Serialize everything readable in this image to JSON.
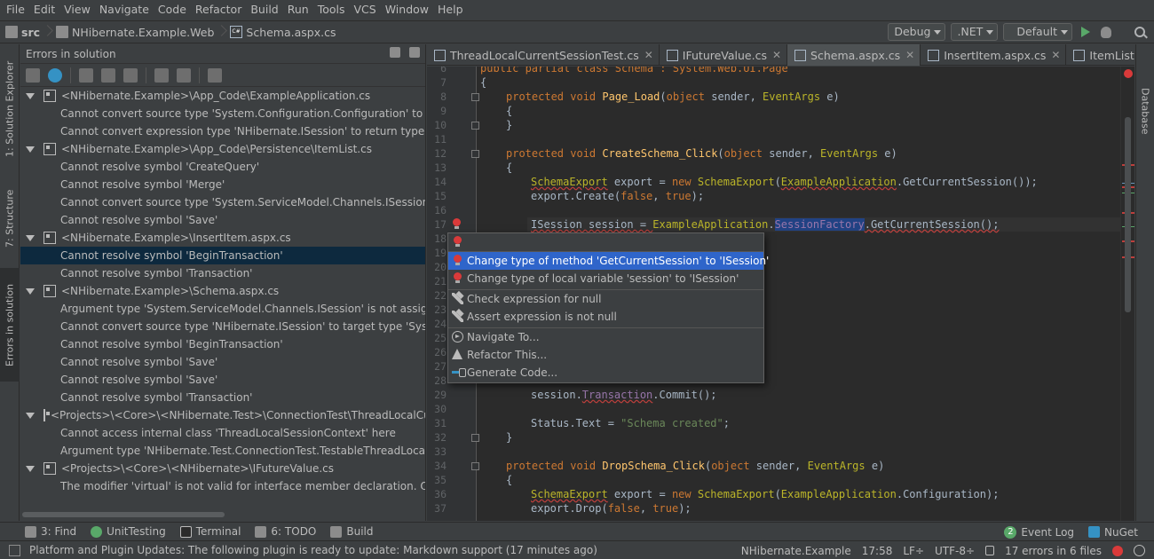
{
  "menu": [
    "File",
    "Edit",
    "View",
    "Navigate",
    "Code",
    "Refactor",
    "Build",
    "Run",
    "Tools",
    "VCS",
    "Window",
    "Help"
  ],
  "breadcrumb": [
    "src",
    "NHibernate.Example.Web",
    "Schema.aspx.cs"
  ],
  "run_config": {
    "configuration": "Debug",
    "platform": ".NET",
    "profile": "Default"
  },
  "left_stripe_tabs": [
    "1: Solution Explorer",
    "7: Structure",
    "Errors in solution"
  ],
  "errors_panel": {
    "title": "Errors in solution",
    "groups": [
      {
        "path": "<NHibernate.Example>\\App_Code\\ExampleApplication.cs",
        "items": [
          "Cannot convert source type 'System.Configuration.Configuration' to target type",
          "Cannot convert expression type 'NHibernate.ISession' to return type 'System.Se"
        ]
      },
      {
        "path": "<NHibernate.Example>\\App_Code\\Persistence\\ItemList.cs",
        "items": [
          "Cannot resolve symbol 'CreateQuery'",
          "Cannot resolve symbol 'Merge'",
          "Cannot convert source type 'System.ServiceModel.Channels.ISession' to target",
          "Cannot resolve symbol 'Save'"
        ]
      },
      {
        "path": "<NHibernate.Example>\\InsertItem.aspx.cs",
        "items": [
          "Cannot resolve symbol 'BeginTransaction'",
          "Cannot resolve symbol 'Transaction'"
        ]
      },
      {
        "path": "<NHibernate.Example>\\Schema.aspx.cs",
        "items": [
          "Argument type 'System.ServiceModel.Channels.ISession' is not assignable to p",
          "Cannot convert source type 'NHibernate.ISession' to target type 'System.Servic",
          "Cannot resolve symbol 'BeginTransaction'",
          "Cannot resolve symbol 'Save'",
          "Cannot resolve symbol 'Save'",
          "Cannot resolve symbol 'Transaction'"
        ]
      },
      {
        "path": "<Projects>\\<Core>\\<NHibernate.Test>\\ConnectionTest\\ThreadLocalCurrentS",
        "items": [
          "Cannot access internal class 'ThreadLocalSessionContext' here",
          "Argument type 'NHibernate.Test.ConnectionTest.TestableThreadLocalContext"
        ]
      },
      {
        "path": "<Projects>\\<Core>\\<NHibernate>\\IFutureValue.cs",
        "items": [
          "The modifier 'virtual' is not valid for interface member declaration. Only 'new'"
        ]
      }
    ],
    "selected_item": "Cannot resolve symbol 'BeginTransaction'"
  },
  "editor_tabs": [
    "ThreadLocalCurrentSessionTest.cs",
    "IFutureValue.cs",
    "Schema.aspx.cs",
    "InsertItem.aspx.cs",
    "ItemList.cs"
  ],
  "active_tab": "Schema.aspx.cs",
  "line_numbers": [
    "6",
    "7",
    "8",
    "9",
    "10",
    "11",
    "12",
    "13",
    "14",
    "15",
    "16",
    "17",
    "18",
    "19",
    "20",
    "21",
    "22",
    "23",
    "24",
    "25",
    "26",
    "27",
    "28",
    "29",
    "30",
    "31",
    "32",
    "33",
    "34",
    "35",
    "36",
    "37"
  ],
  "code": {
    "l6": "public partial class Schema : System.Web.UI.Page",
    "l7": "{",
    "l8a": "protected void ",
    "l8b": "Page_Load",
    "l8c": "(",
    "l8d": "object",
    "l8e": " sender, ",
    "l8f": "EventArgs",
    "l8g": " e)",
    "l9": "{",
    "l10": "}",
    "l12a": "protected void ",
    "l12b": "CreateSchema_Click",
    "l12c": "(",
    "l12d": "object",
    "l12e": " sender, ",
    "l12f": "EventArgs",
    "l12g": " e)",
    "l13": "{",
    "l14a": "SchemaExport",
    "l14b": " export = ",
    "l14c": "new ",
    "l14d": "SchemaExport",
    "l14e": "(",
    "l14f": "ExampleApplication",
    "l14g": ".GetCurrentSession());",
    "l15a": "export.Create(",
    "l15b": "false",
    "l15c": ", ",
    "l15d": "true",
    "l15e": ");",
    "l17a": "ISession session = ",
    "l17b": "ExampleApplication",
    "l17c": ".",
    "l17d": "SessionFactory",
    "l17e": ".GetCurrentSession();",
    "l29a": "session.",
    "l29b": "Transaction",
    "l29c": ".Commit();",
    "l31a": "Status.Text = ",
    "l31b": "\"Schema created\"",
    "l31c": ";",
    "l32": "}",
    "l34a": "protected void ",
    "l34b": "DropSchema_Click",
    "l34c": "(",
    "l34d": "object",
    "l34e": " sender, ",
    "l34f": "EventArgs",
    "l34g": " e)",
    "l35": "{",
    "l36a": "SchemaExport",
    "l36b": " export = ",
    "l36c": "new ",
    "l36d": "SchemaExport",
    "l36e": "(",
    "l36f": "ExampleApplication",
    "l36g": ".Configuration);",
    "l37a": "export.Drop(",
    "l37b": "false",
    "l37c": ", ",
    "l37d": "true",
    "l37e": ");"
  },
  "popup": {
    "items": [
      "",
      "Change type of method 'GetCurrentSession' to 'ISession'",
      "Change type of local variable 'session' to 'ISession'",
      "Check expression for null",
      "Assert expression is not null",
      "Navigate To...",
      "Refactor This...",
      "Generate Code..."
    ],
    "selected_index": 1
  },
  "right_stripe_tabs": [
    "Database"
  ],
  "tool_windows": [
    "3: Find",
    "UnitTesting",
    "Terminal",
    "6: TODO",
    "Build",
    "Event Log",
    "NuGet"
  ],
  "event_log_count": "2",
  "status": {
    "message": "Platform and Plugin Updates: The following plugin is ready to update: Markdown support (17 minutes ago)",
    "project": "NHibernate.Example",
    "position": "17:58",
    "line_sep": "LF÷",
    "encoding": "UTF-8÷",
    "errors": "17 errors in 6 files"
  }
}
